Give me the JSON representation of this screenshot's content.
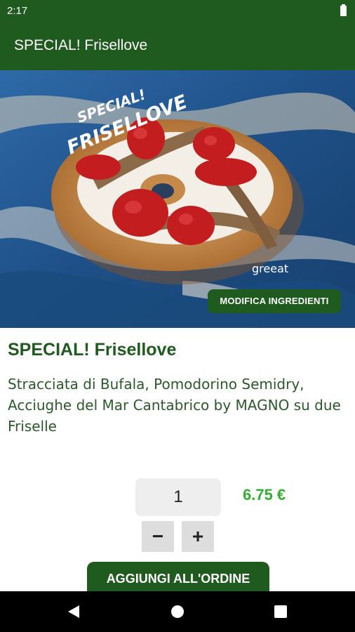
{
  "status_bar": {
    "time": "2:17"
  },
  "app_bar": {
    "title": "SPECIAL! Frisellove"
  },
  "hero": {
    "overlay_text": [
      "SPECIAL!",
      "FRISELLOVE"
    ],
    "watermark": "greeat",
    "modify_label": "MODIFICA INGREDIENTI"
  },
  "product": {
    "title": "SPECIAL! Frisellove",
    "description": "Stracciata di Bufala, Pomodorino Semidry, Acciughe del Mar Cantabrico by MAGNO su due Friselle"
  },
  "order": {
    "quantity": "1",
    "price": "6.75 €",
    "minus_label": "−",
    "plus_label": "+",
    "add_label": "AGGIUNGI ALL'ORDINE"
  },
  "nav_icons": [
    "back-icon",
    "home-icon",
    "recents-icon"
  ]
}
